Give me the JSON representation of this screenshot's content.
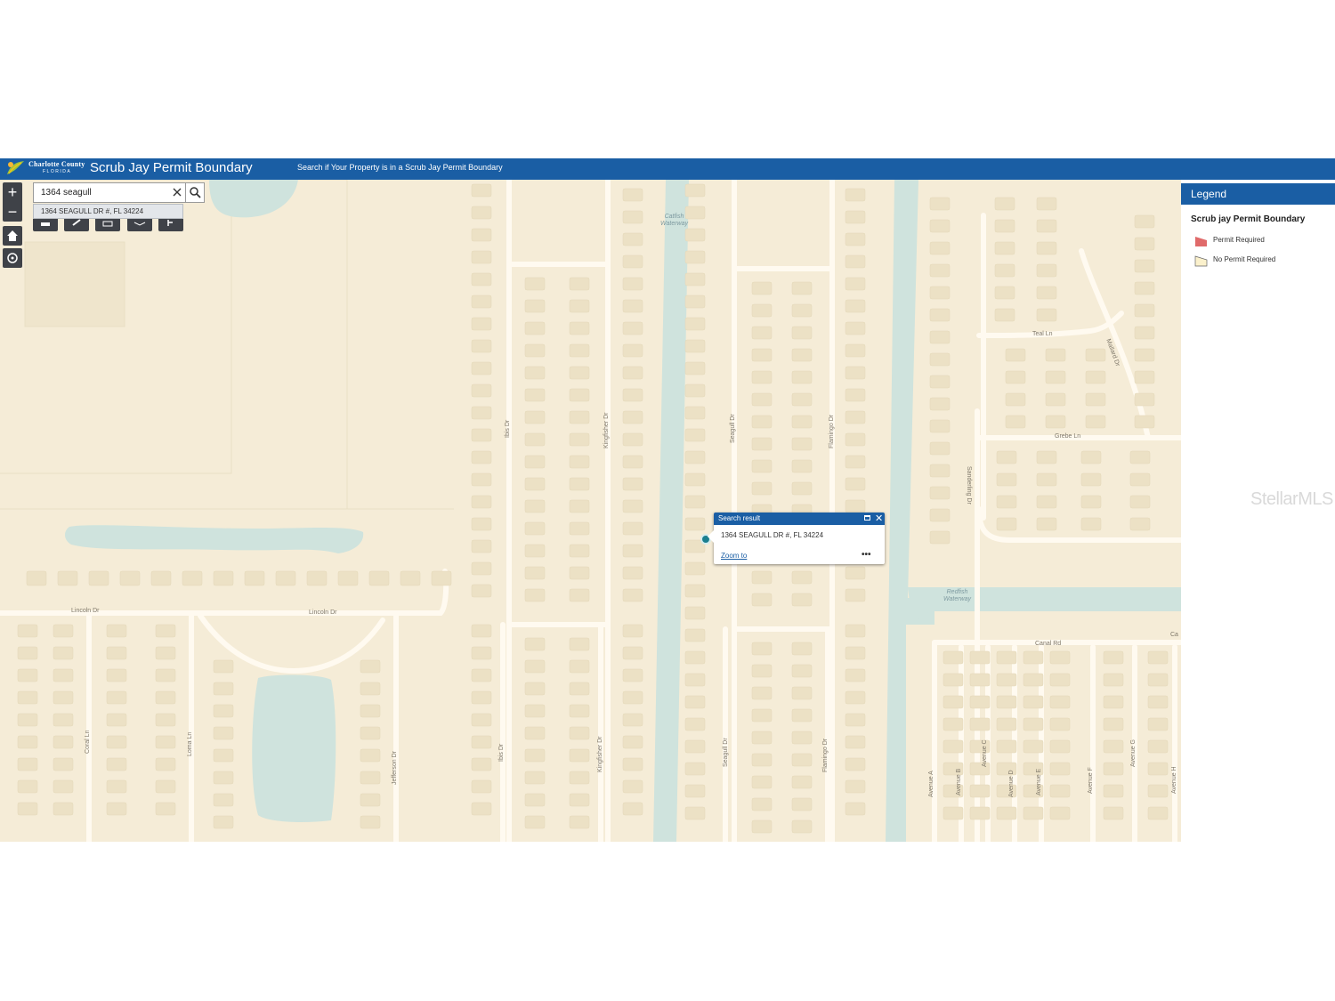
{
  "header": {
    "logo_line1": "Charlotte County",
    "logo_line2": "FLORIDA",
    "title": "Scrub Jay Permit Boundary",
    "subtitle": "Search if Your Property is in a Scrub Jay Permit Boundary",
    "colors": {
      "brand_blue": "#1a5ea4"
    }
  },
  "search": {
    "value": "1364 seagull",
    "suggestion": "1364 SEAGULL DR #, FL 34224"
  },
  "map_controls": {
    "zoom_in_label": "+",
    "zoom_out_label": "−",
    "buttons": [
      "zoom-in",
      "zoom-out",
      "home-icon",
      "locate-icon"
    ],
    "toolbar_icons": [
      "basemap-icon",
      "draw-icon",
      "print-icon",
      "layers-icon",
      "measure-icon"
    ]
  },
  "popup": {
    "title": "Search result",
    "address": "1364 SEAGULL DR #, FL 34224",
    "zoom_to": "Zoom to",
    "more": "•••"
  },
  "legend": {
    "title": "Legend",
    "layer_title": "Scrub jay Permit Boundary",
    "items": [
      {
        "label": "Permit Required",
        "color": "#e06a6a"
      },
      {
        "label": "No Permit Required",
        "color": "#fbf1cc"
      }
    ]
  },
  "map_labels": {
    "streets": {
      "teal": "Teal Ln",
      "mallard": "Mallard Dr",
      "grebe": "Grebe Ln",
      "sanderling": "Sanderling Dr",
      "lincoln1": "Lincoln Dr",
      "lincoln2": "Lincoln Dr",
      "canal": "Canal Rd",
      "ca": "Ca",
      "ibis1": "Ibis Dr",
      "kingfisher1": "Kingfisher Dr",
      "seagull1": "Seagull Dr",
      "flamingo1": "Flamingo Dr",
      "coral": "Coral Ln",
      "loma": "Loma Ln",
      "jefferson": "Jefferson Dr",
      "ibis2": "Ibis Dr",
      "kingfisher2": "Kingfisher Dr",
      "seagull2": "Seagull Dr",
      "flamingo2": "Flamingo Dr",
      "ave_a": "Avenue A",
      "ave_b": "Avenue B",
      "ave_c": "Avenue C",
      "ave_d": "Avenue D",
      "ave_e": "Avenue E",
      "ave_f": "Avenue F",
      "ave_g": "Avenue G",
      "ave_h": "Avenue H"
    },
    "waterways": {
      "catfish": "Catfish\nWaterway",
      "redfish": "Redfish\nWaterway"
    }
  },
  "watermark": "StellarMLS"
}
